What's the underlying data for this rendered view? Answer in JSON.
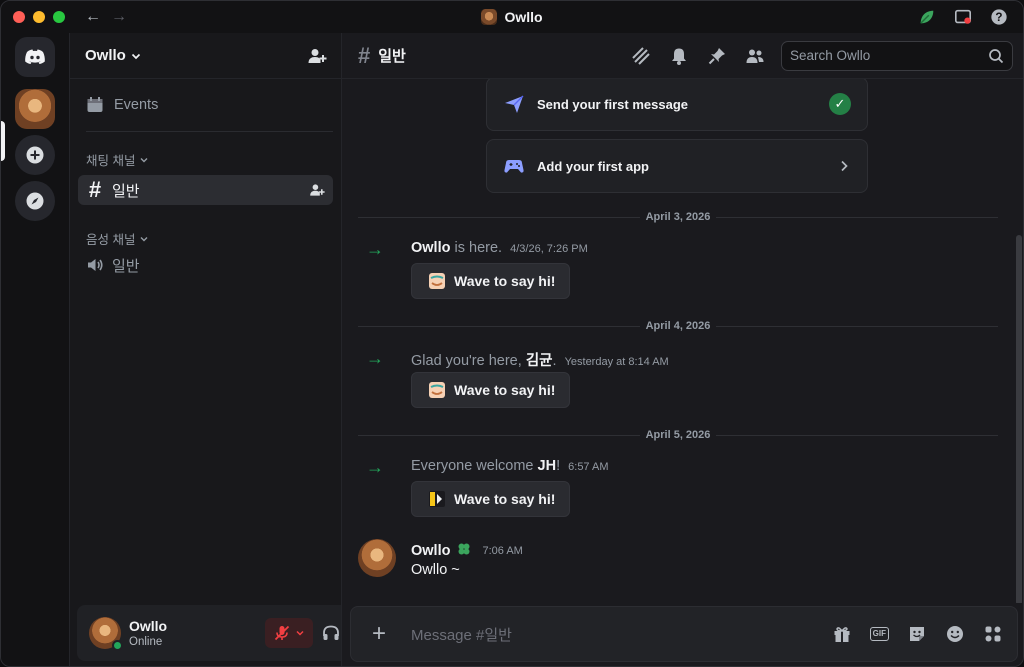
{
  "window": {
    "title": "Owllo"
  },
  "server": {
    "name": "Owllo"
  },
  "sidebar": {
    "events_label": "Events",
    "categories": [
      {
        "label": "채팅 채널",
        "channels": [
          {
            "name": "일반",
            "active": true
          }
        ]
      },
      {
        "label": "음성 채널",
        "channels": [
          {
            "name": "일반",
            "active": false
          }
        ]
      }
    ]
  },
  "user": {
    "name": "Owllo",
    "status": "Online"
  },
  "channel": {
    "name": "일반"
  },
  "search": {
    "placeholder": "Search Owllo"
  },
  "onboarding": {
    "send_message": "Send your first message",
    "add_app": "Add your first app"
  },
  "feed": {
    "dates": [
      "April 3, 2026",
      "April 4, 2026",
      "April 5, 2026"
    ],
    "joins": [
      {
        "prefix": "",
        "name": "Owllo",
        "suffix": " is here.",
        "time": "4/3/26, 7:26 PM",
        "button": "Wave to say hi!"
      },
      {
        "prefix": "Glad you're here, ",
        "name": "김균",
        "suffix": ".",
        "time": "Yesterday at 8:14 AM",
        "button": "Wave to say hi!"
      },
      {
        "prefix": "Everyone welcome ",
        "name": "JH",
        "suffix": "!",
        "time": "6:57 AM",
        "button": "Wave to say hi!"
      }
    ],
    "message": {
      "author": "Owllo",
      "time": "7:06 AM",
      "text": "Owllo ~"
    }
  },
  "composer": {
    "placeholder": "Message #일반",
    "gif_label": "GIF"
  },
  "colors": {
    "accent_green": "#23a55a",
    "muted_red": "#f23f42",
    "background": "#1a1a1e"
  }
}
